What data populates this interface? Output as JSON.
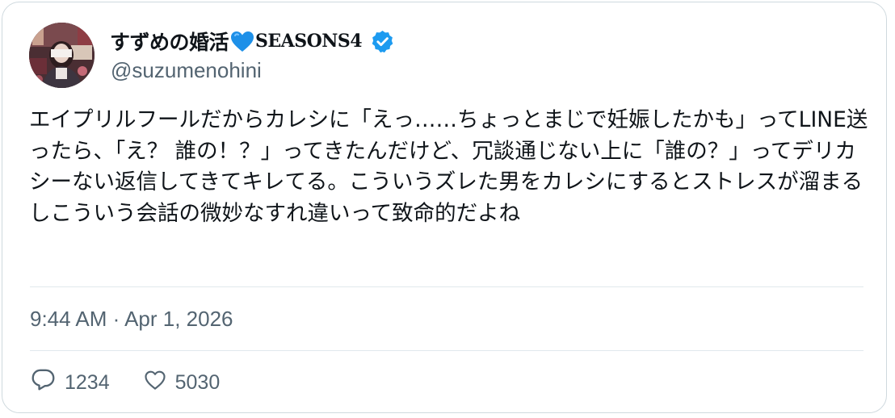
{
  "author": {
    "display_name": "すずめの婚活",
    "heart_emoji": "💙",
    "name_suffix": "SEASONS4",
    "verified_icon": "verified-badge-icon",
    "handle": "@suzumenohini",
    "avatar_icon": "profile-photo"
  },
  "tweet": {
    "text": "エイプリルフールだからカレシに「えっ……ちょっとまじで妊娠したかも」ってLINE送ったら、「え？ 誰の！？」ってきたんだけど、冗談通じない上に「誰の？」ってデリカシーない返信してきてキレてる。こういうズレた男をカレシにするとストレスが溜まるしこういう会話の微妙なすれ違いって致命的だよね",
    "timestamp": "9:44 AM · Apr 1, 2026"
  },
  "actions": {
    "reply_icon": "reply-bubble-icon",
    "reply_count": "1234",
    "like_icon": "heart-outline-icon",
    "like_count": "5030"
  },
  "colors": {
    "text_primary": "#0f1419",
    "text_secondary": "#536471",
    "verified_blue": "#1d9bf0",
    "border": "#cfd9de",
    "divider": "#e1e8ed"
  }
}
